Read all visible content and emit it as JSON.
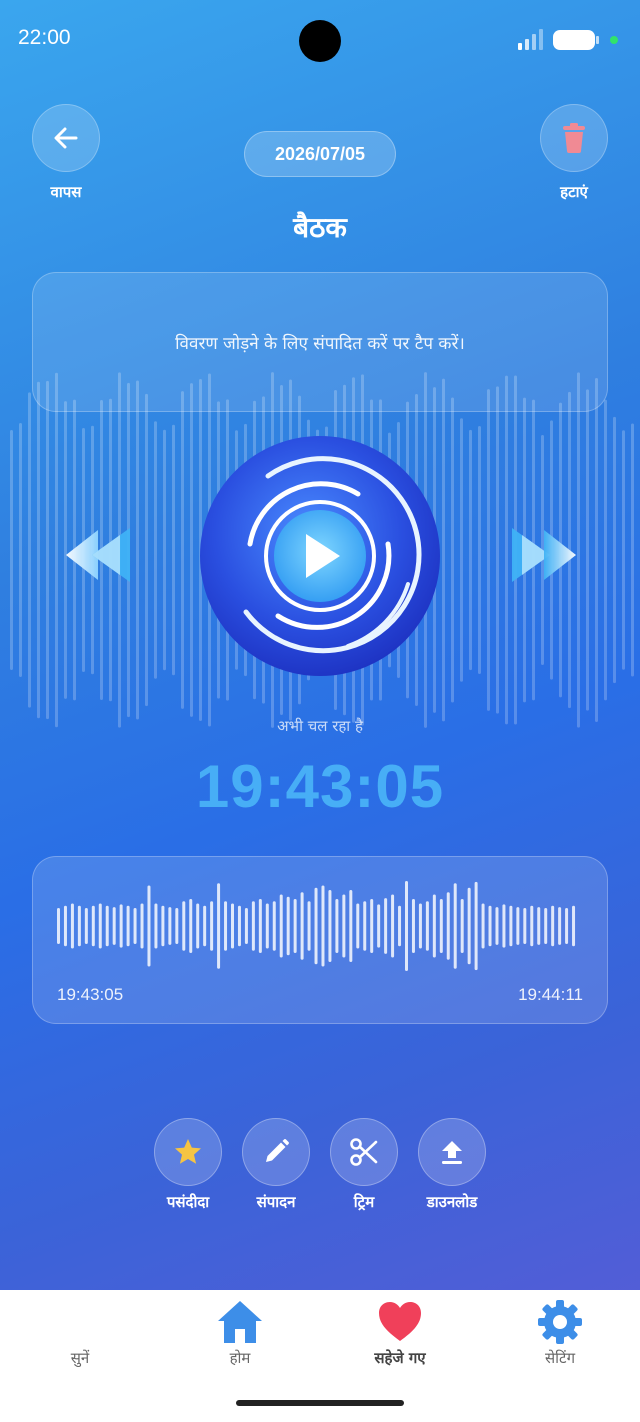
{
  "status_bar": {
    "time": "22:00"
  },
  "header": {
    "back_label": "वापस",
    "delete_label": "हटाएं",
    "date": "2026/07/05",
    "title": "बैठक"
  },
  "description": {
    "placeholder_text": "विवरण जोड़ने के लिए संपादित करें पर टैप करें।"
  },
  "player": {
    "status": "अभी चल रहा है",
    "current_time": "19:43:05",
    "wave_start": "19:43:05",
    "wave_end": "19:44:11"
  },
  "actions": [
    {
      "label": "पसंदीदा",
      "icon": "star-icon"
    },
    {
      "label": "संपादन",
      "icon": "pencil-icon"
    },
    {
      "label": "ट्रिम",
      "icon": "scissors-icon"
    },
    {
      "label": "डाउनलोड",
      "icon": "upload-icon"
    }
  ],
  "nav": [
    {
      "label": "सुनें",
      "icon": "waveform-icon"
    },
    {
      "label": "होम",
      "icon": "home-icon"
    },
    {
      "label": "सहेजे गए",
      "icon": "heart-icon"
    },
    {
      "label": "सेटिंग",
      "icon": "gear-icon"
    }
  ],
  "colors": {
    "accent": "#47aef6",
    "favorite": "#f6c443",
    "delete": "#f08a94",
    "heart": "#f0405a"
  }
}
